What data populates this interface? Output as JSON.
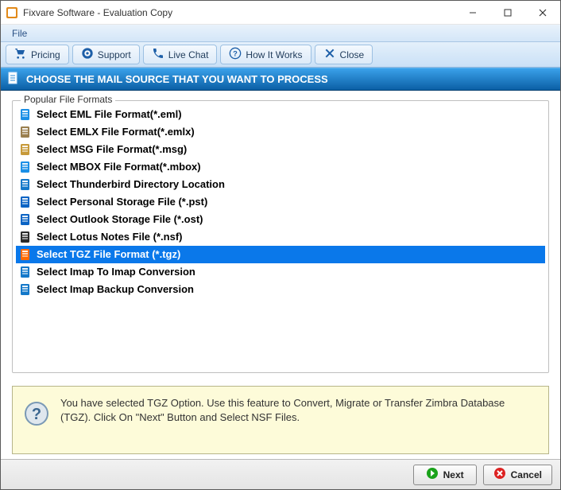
{
  "window": {
    "title": "Fixvare Software - Evaluation Copy"
  },
  "menu": {
    "file": "File"
  },
  "toolbar": {
    "pricing": "Pricing",
    "support": "Support",
    "livechat": "Live Chat",
    "howitworks": "How It Works",
    "close": "Close"
  },
  "heading": "CHOOSE THE MAIL SOURCE THAT YOU WANT TO PROCESS",
  "fieldset_title": "Popular File Formats",
  "formats": [
    {
      "label": "Select EML File Format(*.eml)",
      "icon_color": "#1b8fe6",
      "selected": false
    },
    {
      "label": "Select EMLX File Format(*.emlx)",
      "icon_color": "#9a7f4f",
      "selected": false
    },
    {
      "label": "Select MSG File Format(*.msg)",
      "icon_color": "#c79a3a",
      "selected": false
    },
    {
      "label": "Select MBOX File Format(*.mbox)",
      "icon_color": "#1b8fe6",
      "selected": false
    },
    {
      "label": "Select Thunderbird Directory Location",
      "icon_color": "#1478c9",
      "selected": false
    },
    {
      "label": "Select Personal Storage File (*.pst)",
      "icon_color": "#0b64c4",
      "selected": false
    },
    {
      "label": "Select Outlook Storage File (*.ost)",
      "icon_color": "#0b64c4",
      "selected": false
    },
    {
      "label": "Select Lotus Notes File (*.nsf)",
      "icon_color": "#2b2b2b",
      "selected": false
    },
    {
      "label": "Select TGZ File Format (*.tgz)",
      "icon_color": "#ff6a00",
      "selected": true
    },
    {
      "label": "Select Imap To Imap Conversion",
      "icon_color": "#1478c9",
      "selected": false
    },
    {
      "label": "Select Imap Backup Conversion",
      "icon_color": "#1478c9",
      "selected": false
    }
  ],
  "info_text": "You have selected TGZ Option. Use this feature to Convert, Migrate or Transfer Zimbra Database (TGZ). Click On \"Next\" Button and Select NSF Files.",
  "buttons": {
    "next": "Next",
    "cancel": "Cancel"
  }
}
